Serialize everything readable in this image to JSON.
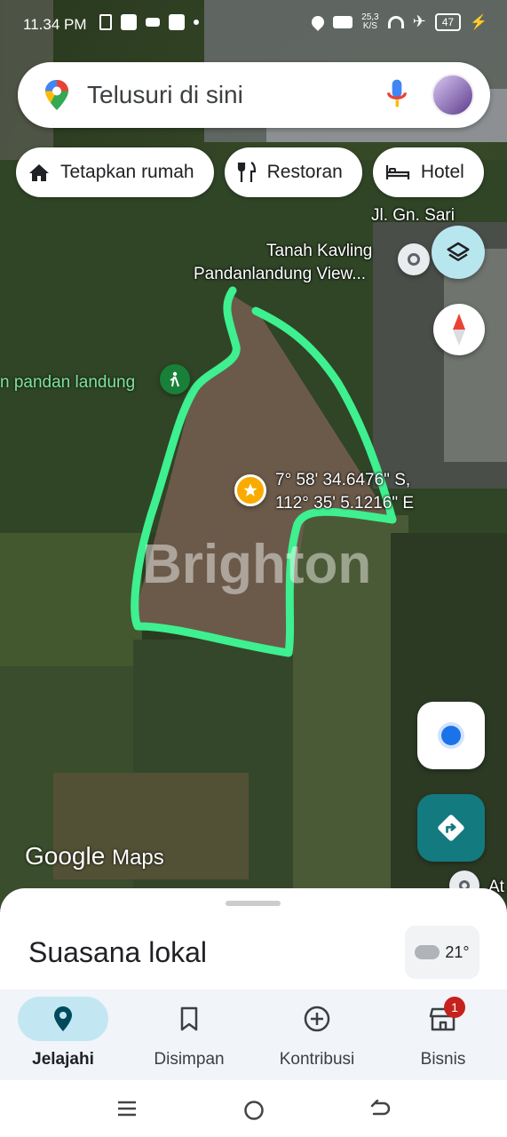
{
  "status_bar": {
    "time": "11.34 PM",
    "network_speed_value": "25,3",
    "network_speed_unit": "K/S",
    "battery": "47"
  },
  "search": {
    "placeholder": "Telusuri di sini"
  },
  "chips": [
    {
      "label": "Tetapkan rumah",
      "icon": "home-icon"
    },
    {
      "label": "Restoran",
      "icon": "restaurant-icon"
    },
    {
      "label": "Hotel",
      "icon": "hotel-icon"
    }
  ],
  "map": {
    "street_label": "Jl. Gn. Sari",
    "poi_label_line1": "Tanah Kavling",
    "poi_label_line2": "Pandanlandung View...",
    "park_label": "n pandan landung",
    "coordinate_line1": "7° 58' 34.6476\" S,",
    "coordinate_line2": "112° 35' 5.1216\" E",
    "watermark": "Brighton",
    "partial_label": "At",
    "attribution_google": "Google",
    "attribution_maps": "Maps",
    "outline_color": "#3ef08f"
  },
  "sheet": {
    "title": "Suasana lokal",
    "temperature": "21°"
  },
  "bottom_nav": [
    {
      "label": "Jelajahi",
      "active": true
    },
    {
      "label": "Disimpan",
      "active": false
    },
    {
      "label": "Kontribusi",
      "active": false
    },
    {
      "label": "Bisnis",
      "active": false,
      "badge": "1"
    }
  ],
  "colors": {
    "accent_blue": "#1a73e8",
    "directions_teal": "#137a7f",
    "active_pill": "#c2e7f3"
  }
}
